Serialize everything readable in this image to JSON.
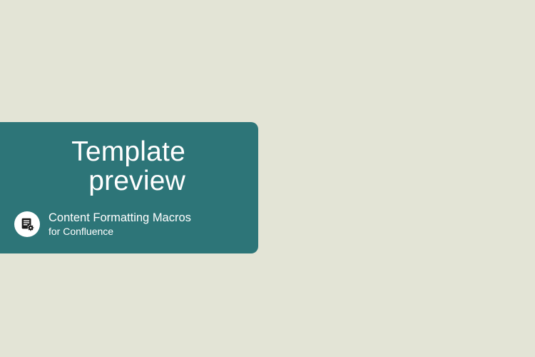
{
  "card": {
    "title_line1": "Template",
    "title_line2": "preview",
    "footer_line1": "Content Formatting Macros",
    "footer_line2": "for Confluence"
  },
  "colors": {
    "background": "#e3e4d6",
    "card": "#2d7578",
    "text": "#ffffff",
    "icon_bg": "#ffffff",
    "icon_fill": "#1b1b1b"
  }
}
